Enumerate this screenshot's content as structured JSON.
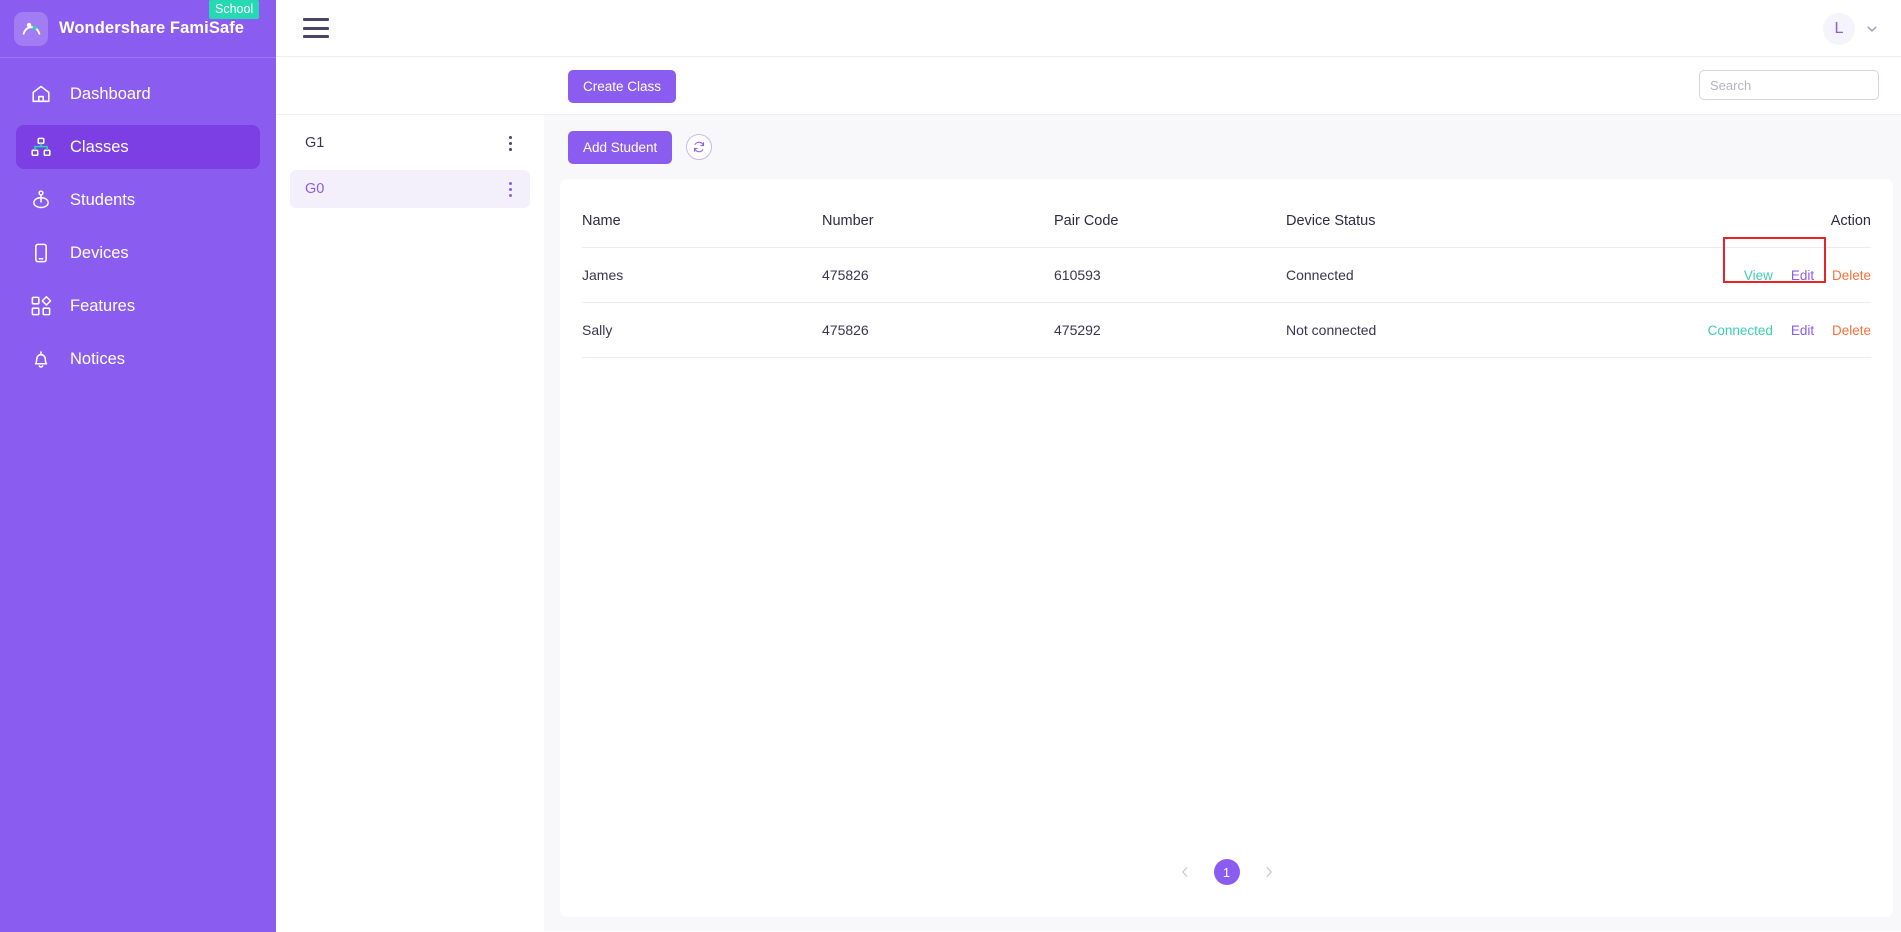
{
  "sidebar": {
    "brand": {
      "title": "Wondershare FamiSafe",
      "badge": "School",
      "logo_icon": "famisafe-logo-icon"
    },
    "items": [
      {
        "label": "Dashboard",
        "icon": "home-icon",
        "active": false
      },
      {
        "label": "Classes",
        "icon": "sitemap-icon",
        "active": true
      },
      {
        "label": "Students",
        "icon": "students-icon",
        "active": false
      },
      {
        "label": "Devices",
        "icon": "phone-icon",
        "active": false
      },
      {
        "label": "Features",
        "icon": "grid-icon",
        "active": false
      },
      {
        "label": "Notices",
        "icon": "bell-icon",
        "active": false
      }
    ]
  },
  "topbar": {
    "menu_icon": "hamburger-icon",
    "avatar_initial": "L",
    "caret_icon": "chevron-down-icon"
  },
  "subbar": {
    "create_class_label": "Create Class",
    "search_placeholder": "Search",
    "search_value": ""
  },
  "classes": {
    "items": [
      {
        "name": "G1",
        "selected": false
      },
      {
        "name": "G0",
        "selected": true
      }
    ]
  },
  "toolbar": {
    "add_student_label": "Add Student",
    "refresh_icon": "refresh-icon"
  },
  "table": {
    "columns": [
      "Name",
      "Number",
      "Pair Code",
      "Device Status",
      "Action"
    ],
    "rows": [
      {
        "name": "James",
        "number": "475826",
        "pair_code": "610593",
        "pair_code_alert": false,
        "device_status": "Connected",
        "actions": [
          {
            "label": "View",
            "kind": "view"
          },
          {
            "label": "Edit",
            "kind": "edit"
          },
          {
            "label": "Delete",
            "kind": "delete"
          }
        ]
      },
      {
        "name": "Sally",
        "number": "475826",
        "pair_code": "475292",
        "pair_code_alert": true,
        "device_status": "Not connected",
        "actions": [
          {
            "label": "Connected",
            "kind": "view"
          },
          {
            "label": "Edit",
            "kind": "edit"
          },
          {
            "label": "Delete",
            "kind": "delete"
          }
        ]
      }
    ]
  },
  "pagination": {
    "prev_icon": "chevron-left-icon",
    "next_icon": "chevron-right-icon",
    "current_page": "1"
  },
  "colors": {
    "brand_purple": "#8b5cf0",
    "active_purple": "#7c3fe4",
    "badge_teal": "#27d9b3",
    "link_teal": "#3ccfb4",
    "alert_orange": "#f7713c",
    "highlight_red": "#e8232a"
  }
}
